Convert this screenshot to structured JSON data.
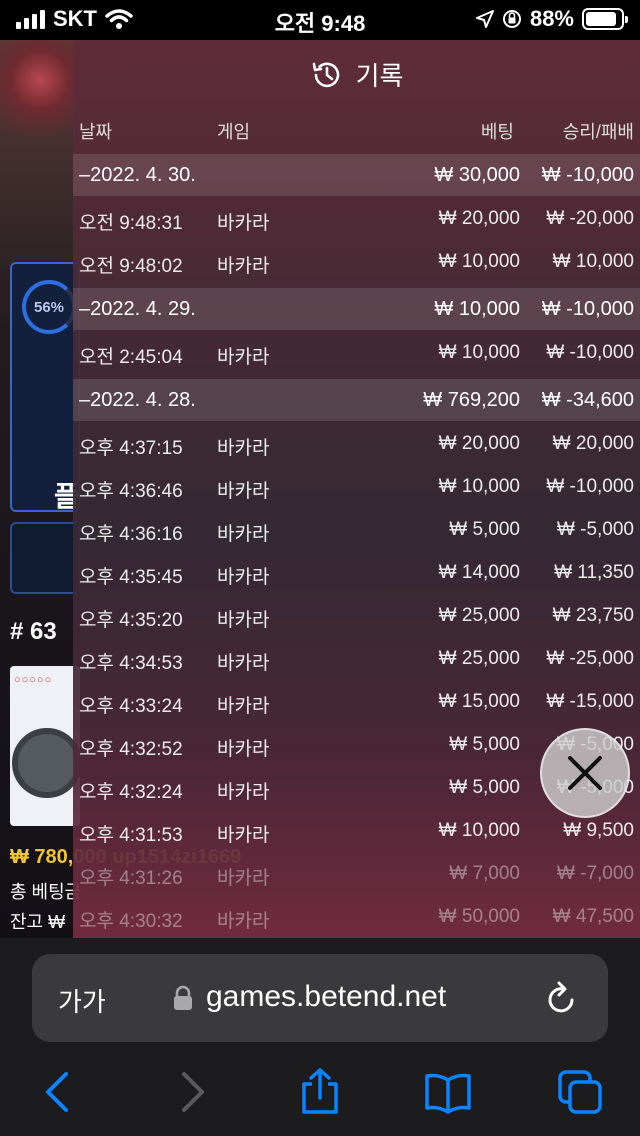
{
  "status_bar": {
    "carrier": "SKT",
    "time": "오전 9:48",
    "battery_percent": "88%",
    "battery_level": 0.88
  },
  "background": {
    "ring_percent": "56%",
    "play_label": "플",
    "table_number": "# 63",
    "balance_text": "₩ 780,000 up1514zi1669",
    "total_bet_label": "총 베팅금",
    "balance_label": "잔고 ₩"
  },
  "history": {
    "title": "기록",
    "columns": {
      "date": "날짜",
      "game": "게임",
      "bet": "베팅",
      "result": "승리/패배"
    },
    "rows": [
      {
        "type": "day",
        "date": "–2022. 4. 30.",
        "game": "",
        "bet": "₩ 30,000",
        "result": "₩ -10,000"
      },
      {
        "type": "entry",
        "date": "오전 9:48:31",
        "game": "바카라",
        "bet": "₩ 20,000",
        "result": "₩ -20,000"
      },
      {
        "type": "entry",
        "date": "오전 9:48:02",
        "game": "바카라",
        "bet": "₩ 10,000",
        "result": "₩ 10,000"
      },
      {
        "type": "day",
        "date": "–2022. 4. 29.",
        "game": "",
        "bet": "₩ 10,000",
        "result": "₩ -10,000"
      },
      {
        "type": "entry",
        "date": "오전 2:45:04",
        "game": "바카라",
        "bet": "₩ 10,000",
        "result": "₩ -10,000"
      },
      {
        "type": "day",
        "date": "–2022. 4. 28.",
        "game": "",
        "bet": "₩ 769,200",
        "result": "₩ -34,600"
      },
      {
        "type": "entry",
        "date": "오후 4:37:15",
        "game": "바카라",
        "bet": "₩ 20,000",
        "result": "₩ 20,000"
      },
      {
        "type": "entry",
        "date": "오후 4:36:46",
        "game": "바카라",
        "bet": "₩ 10,000",
        "result": "₩ -10,000"
      },
      {
        "type": "entry",
        "date": "오후 4:36:16",
        "game": "바카라",
        "bet": "₩ 5,000",
        "result": "₩ -5,000"
      },
      {
        "type": "entry",
        "date": "오후 4:35:45",
        "game": "바카라",
        "bet": "₩ 14,000",
        "result": "₩ 11,350"
      },
      {
        "type": "entry",
        "date": "오후 4:35:20",
        "game": "바카라",
        "bet": "₩ 25,000",
        "result": "₩ 23,750"
      },
      {
        "type": "entry",
        "date": "오후 4:34:53",
        "game": "바카라",
        "bet": "₩ 25,000",
        "result": "₩ -25,000"
      },
      {
        "type": "entry",
        "date": "오후 4:33:24",
        "game": "바카라",
        "bet": "₩ 15,000",
        "result": "₩ -15,000"
      },
      {
        "type": "entry",
        "date": "오후 4:32:52",
        "game": "바카라",
        "bet": "₩ 5,000",
        "result": "₩ -5,000"
      },
      {
        "type": "entry",
        "date": "오후 4:32:24",
        "game": "바카라",
        "bet": "₩ 5,000",
        "result": "₩ -5,000"
      },
      {
        "type": "entry",
        "date": "오후 4:31:53",
        "game": "바카라",
        "bet": "₩ 10,000",
        "result": "₩ 9,500"
      },
      {
        "type": "entry",
        "date": "오후 4:31:26",
        "game": "바카라",
        "bet": "₩ 7,000",
        "result": "₩ -7,000",
        "faded": true
      },
      {
        "type": "entry",
        "date": "오후 4:30:32",
        "game": "바카라",
        "bet": "₩ 50,000",
        "result": "₩ 47,500",
        "faded": true
      }
    ]
  },
  "browser": {
    "aa_label": "가가",
    "url": "games.betend.net"
  },
  "colors": {
    "accent_blue": "#0a84ff",
    "overlay_tint": "#622c3a",
    "gold": "#f0c531"
  },
  "icons": [
    "history-icon",
    "close-icon",
    "lock-icon",
    "reload-icon",
    "back-icon",
    "forward-icon",
    "share-icon",
    "bookmarks-icon",
    "tabs-icon"
  ]
}
